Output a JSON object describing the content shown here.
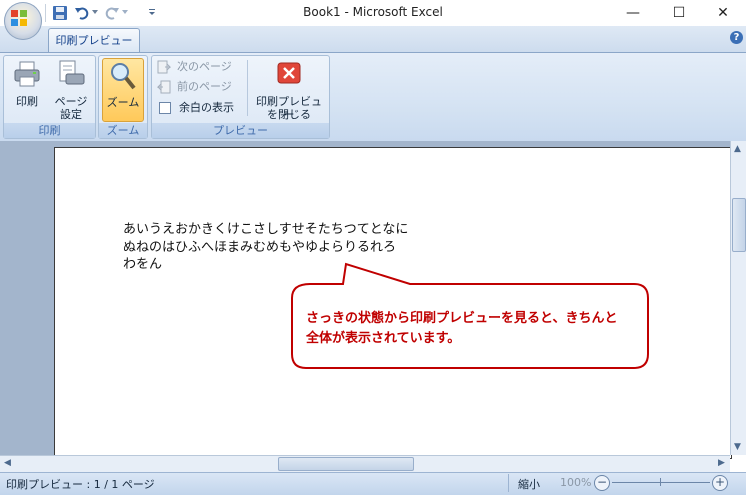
{
  "window": {
    "title": "Book1 - Microsoft Excel",
    "minimize": "—",
    "maximize": "☐",
    "close": "✕"
  },
  "ribbon": {
    "tab": "印刷プレビュー",
    "help": "?",
    "groups": {
      "print": {
        "label": "印刷",
        "print_button": "印刷",
        "page_setup_line1": "ページ",
        "page_setup_line2": "設定"
      },
      "zoom": {
        "label": "ズーム",
        "zoom_button": "ズーム"
      },
      "preview": {
        "label": "プレビュー",
        "next_page": "次のページ",
        "prev_page": "前のページ",
        "show_margins": "余白の表示",
        "close_line1": "印刷プレビュー",
        "close_line2": "を閉じる"
      }
    }
  },
  "page": {
    "lines": [
      "あいうえおかきくけこさしすせそたちつてとなに",
      "ぬねのはひふへほまみむめもやゆよらりるれろ",
      "わをん"
    ]
  },
  "callout": {
    "line1": "さっきの状態から印刷プレビューを見ると、きちんと",
    "line2": "全体が表示されています。",
    "color": "#c00000"
  },
  "statusbar": {
    "status": "印刷プレビュー : 1 / 1 ページ",
    "zoom_label": "縮小",
    "zoom_value": "100%"
  }
}
